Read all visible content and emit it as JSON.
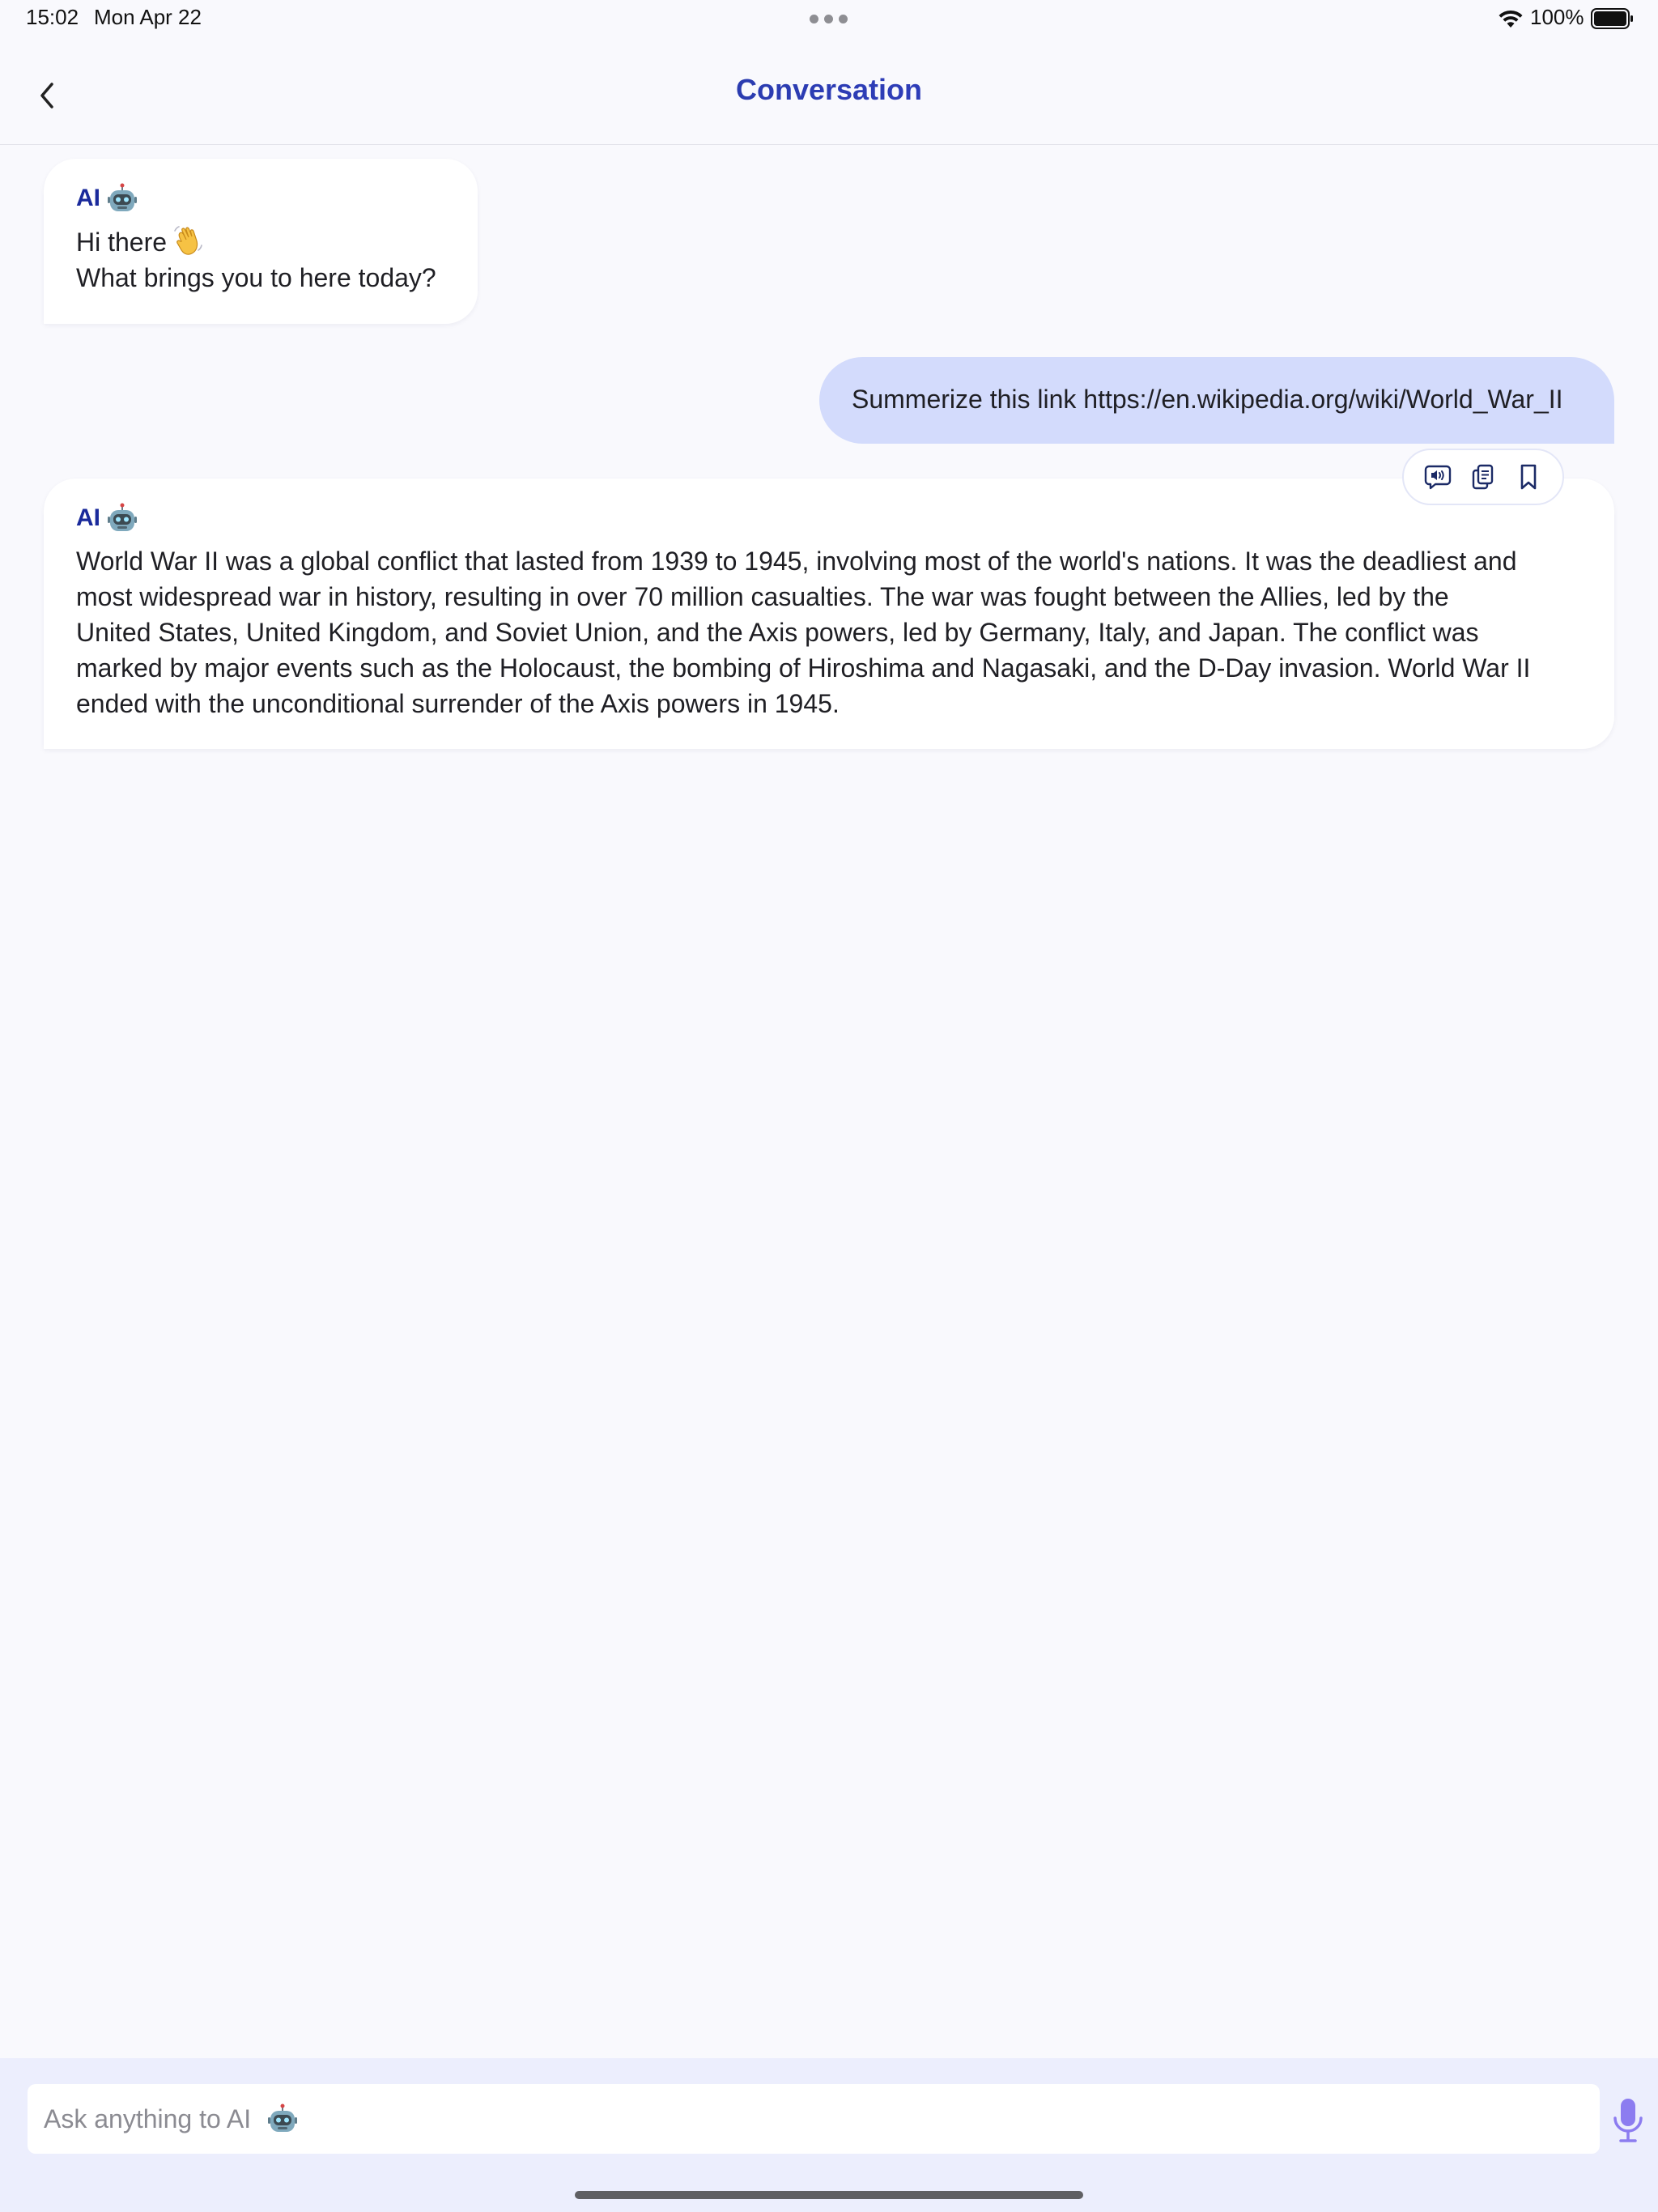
{
  "status_bar": {
    "time": "15:02",
    "date": "Mon Apr 22",
    "battery": "100%",
    "icons": [
      "wifi-icon",
      "battery-icon",
      "more-dots-icon"
    ]
  },
  "nav": {
    "title": "Conversation",
    "back_icon": "chevron-left-icon"
  },
  "messages": [
    {
      "sender": "AI",
      "icon": "robot-icon",
      "lines": [
        "Hi there",
        "What brings you to here today?"
      ],
      "emoji": "waving-hand-icon"
    },
    {
      "sender": "user",
      "text": "Summerize this link https://en.wikipedia.org/wiki/World_War_II"
    },
    {
      "sender": "AI",
      "icon": "robot-icon",
      "lines": [
        "World War II was a global conflict that lasted from 1939 to 1945, involving most of the world's nations. It was the deadliest and",
        "most widespread war in history, resulting in over 70 million casualties. The war was fought between the Allies, led by the",
        "United States, United Kingdom, and Soviet Union, and the Axis powers, led by Germany, Italy, and Japan. The conflict was",
        "marked by major events such as the Holocaust, the bombing of Hiroshima and Nagasaki, and the D-Day invasion. World War II",
        "ended with the unconditional surrender of the Axis powers in 1945."
      ]
    }
  ],
  "actions": [
    "speaker-icon",
    "copy-icon",
    "bookmark-icon"
  ],
  "composer": {
    "placeholder": "Ask anything to AI",
    "placeholder_icon": "robot-icon",
    "mic_icon": "microphone-icon"
  },
  "colors": {
    "background": "#f9f9fd",
    "user_bubble": "#d3dbfc",
    "ai_sender": "#1a2a9b",
    "composer_bg": "#eceefd",
    "mic": "#8c7cf0"
  }
}
